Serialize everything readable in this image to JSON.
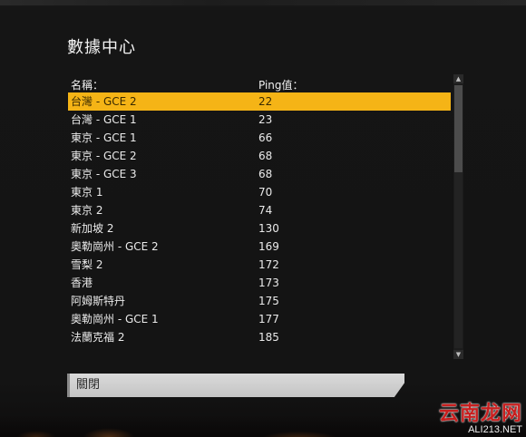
{
  "dialog": {
    "title": "數據中心",
    "columns": {
      "name": "名稱：",
      "ping": "Ping值："
    },
    "selected_index": 0,
    "servers": [
      {
        "name": "台灣 - GCE 2",
        "ping": "22"
      },
      {
        "name": "台灣 - GCE 1",
        "ping": "23"
      },
      {
        "name": "東京 - GCE 1",
        "ping": "66"
      },
      {
        "name": "東京 - GCE 2",
        "ping": "68"
      },
      {
        "name": "東京 - GCE 3",
        "ping": "68"
      },
      {
        "name": "東京 1",
        "ping": "70"
      },
      {
        "name": "東京 2",
        "ping": "74"
      },
      {
        "name": "新加坡 2",
        "ping": "130"
      },
      {
        "name": "奧勒崗州 - GCE 2",
        "ping": "169"
      },
      {
        "name": "雪梨 2",
        "ping": "172"
      },
      {
        "name": "香港",
        "ping": "173"
      },
      {
        "name": "阿姆斯特丹",
        "ping": "175"
      },
      {
        "name": "奧勒崗州 - GCE 1",
        "ping": "177"
      },
      {
        "name": "法蘭克福 2",
        "ping": "185"
      }
    ],
    "scrollbar": {
      "up_icon": "▲",
      "down_icon": "▼"
    },
    "close_label": "關閉"
  },
  "watermark": {
    "site_cn": "云南龙网",
    "site_en": "ALI213.NET"
  },
  "colors": {
    "selected_row": "#f5b416",
    "background": "#141414",
    "close_button": "#cfcfcf"
  }
}
